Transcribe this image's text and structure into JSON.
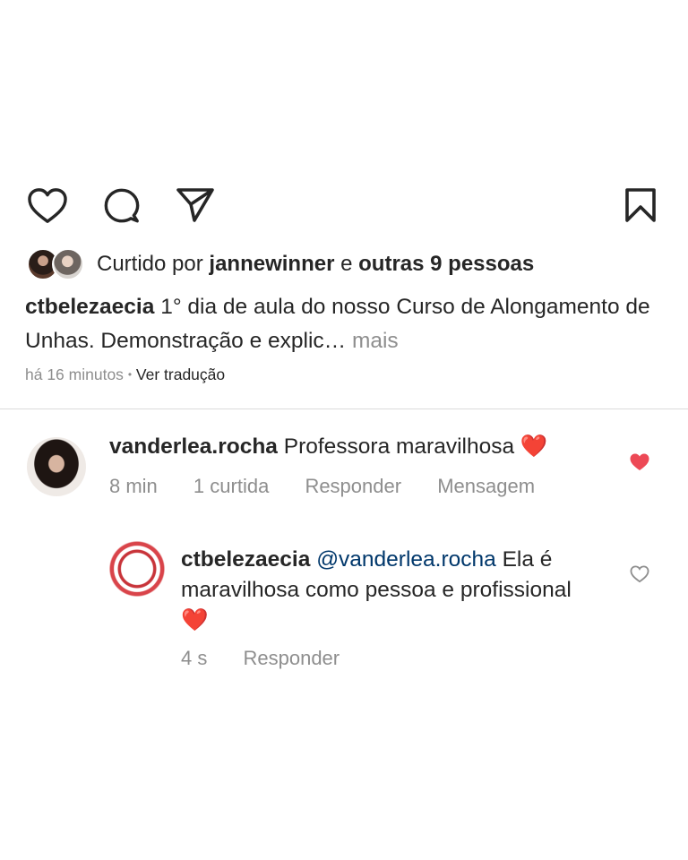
{
  "colors": {
    "text": "#262626",
    "muted": "#8e8e8e",
    "mention": "#00376b",
    "heart": "#ed4956",
    "divider": "#dbdbdb"
  },
  "actions": {
    "like_icon": "heart-outline-icon",
    "comment_icon": "comment-bubble-icon",
    "share_icon": "paper-plane-icon",
    "save_icon": "bookmark-icon"
  },
  "likes": {
    "prefix": "Curtido por",
    "user": "jannewinner",
    "conj": "e",
    "others": "outras 9 pessoas"
  },
  "caption": {
    "username": "ctbelezaecia",
    "text": "1° dia de aula do nosso Curso de Alongamento de Unhas. Demonstração e explic",
    "ellipsis": "…",
    "more": "mais"
  },
  "post_meta": {
    "time": "há 16 minutos",
    "sep": "•",
    "translate": "Ver tradução"
  },
  "comments": [
    {
      "username": "vanderlea.rocha",
      "text": "Professora maravilhosa",
      "emoji": "❤️",
      "time": "8 min",
      "likes": "1 curtida",
      "reply": "Responder",
      "message": "Mensagem",
      "liked": true
    },
    {
      "username": "ctbelezaecia",
      "mention": "@vanderlea.rocha",
      "text": "Ela é maravilhosa como pessoa e profissional",
      "emoji": "❤️",
      "time": "4 s",
      "reply": "Responder",
      "liked": false
    }
  ]
}
